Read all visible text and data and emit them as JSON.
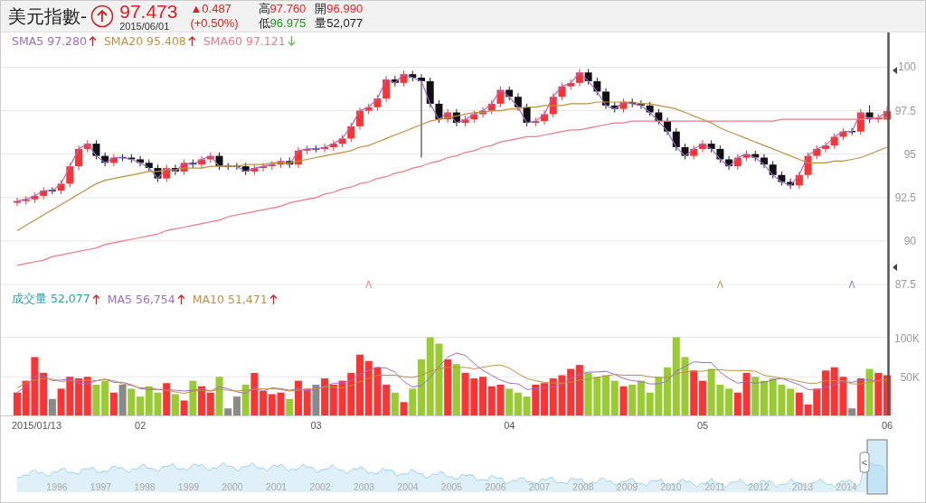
{
  "header": {
    "title": "美元指數-",
    "rising": true,
    "price": "97.473",
    "date": "2015/06/01",
    "change": "▲0.487",
    "change_pct": "(+0.50%)",
    "stats": [
      {
        "label": "高",
        "value": "97.760",
        "color": "#ff1a1a"
      },
      {
        "label": "開",
        "value": "96.990",
        "color": "#ff1a1a"
      },
      {
        "label": "低",
        "value": "96.975",
        "color": "#1a9a1a"
      },
      {
        "label": "量",
        "value": "52,077",
        "color": "#222222"
      }
    ]
  },
  "price_legend": [
    {
      "value": "97.280",
      "rising": true
    },
    {
      "value": "95.408",
      "rising": true
    },
    {
      "value": "97.121",
      "rising": false
    }
  ],
  "price_chart": {
    "chart_data": {
      "type": "candlestick",
      "grid": true,
      "ylim": [
        87.5,
        102
      ],
      "yticks": [
        87.5,
        90,
        92.5,
        95,
        97.5,
        100
      ],
      "ohlc": [
        [
          92.2,
          92.5,
          92.0,
          92.3
        ],
        [
          92.3,
          92.6,
          92.1,
          92.4
        ],
        [
          92.4,
          92.8,
          92.2,
          92.6
        ],
        [
          92.6,
          93.1,
          92.4,
          92.9
        ],
        [
          92.9,
          93.1,
          92.7,
          92.9
        ],
        [
          92.9,
          93.5,
          92.7,
          93.3
        ],
        [
          93.3,
          94.5,
          93.1,
          94.3
        ],
        [
          94.3,
          95.5,
          94.1,
          95.3
        ],
        [
          95.3,
          95.8,
          95.1,
          95.6
        ],
        [
          95.6,
          95.8,
          94.7,
          94.9
        ],
        [
          94.9,
          95.1,
          94.3,
          94.5
        ],
        [
          94.5,
          95.0,
          94.3,
          94.8
        ],
        [
          94.8,
          95.0,
          94.6,
          94.8
        ],
        [
          94.8,
          95.0,
          94.5,
          94.7
        ],
        [
          94.7,
          94.9,
          94.3,
          94.5
        ],
        [
          94.5,
          94.7,
          94.0,
          94.2
        ],
        [
          94.2,
          94.4,
          93.4,
          93.6
        ],
        [
          93.6,
          94.4,
          93.4,
          94.2
        ],
        [
          94.2,
          94.4,
          93.8,
          94.0
        ],
        [
          94.0,
          94.7,
          93.8,
          94.5
        ],
        [
          94.5,
          94.7,
          94.2,
          94.4
        ],
        [
          94.4,
          94.9,
          94.2,
          94.7
        ],
        [
          94.7,
          95.1,
          94.5,
          94.9
        ],
        [
          94.9,
          95.1,
          94.1,
          94.3
        ],
        [
          94.3,
          94.5,
          94.1,
          94.3
        ],
        [
          94.3,
          94.5,
          94.1,
          94.3
        ],
        [
          94.3,
          94.5,
          93.8,
          94.0
        ],
        [
          94.0,
          94.4,
          93.8,
          94.2
        ],
        [
          94.2,
          94.5,
          94.0,
          94.3
        ],
        [
          94.3,
          94.6,
          94.1,
          94.4
        ],
        [
          94.4,
          94.8,
          94.2,
          94.6
        ],
        [
          94.6,
          94.8,
          94.2,
          94.4
        ],
        [
          94.4,
          95.4,
          94.2,
          95.2
        ],
        [
          95.2,
          95.5,
          95.0,
          95.3
        ],
        [
          95.3,
          95.5,
          95.1,
          95.3
        ],
        [
          95.3,
          95.6,
          95.1,
          95.4
        ],
        [
          95.4,
          95.8,
          95.2,
          95.6
        ],
        [
          95.6,
          96.1,
          95.4,
          95.9
        ],
        [
          95.9,
          96.8,
          95.7,
          96.6
        ],
        [
          96.6,
          97.7,
          96.4,
          97.5
        ],
        [
          97.5,
          97.9,
          97.3,
          97.7
        ],
        [
          97.7,
          98.4,
          97.5,
          98.2
        ],
        [
          98.2,
          99.5,
          98.0,
          99.3
        ],
        [
          99.3,
          99.5,
          98.9,
          99.1
        ],
        [
          99.1,
          99.8,
          98.9,
          99.6
        ],
        [
          99.6,
          99.8,
          99.2,
          99.4
        ],
        [
          99.4,
          99.6,
          94.8,
          99.2
        ],
        [
          99.2,
          99.4,
          97.7,
          97.9
        ],
        [
          97.9,
          98.1,
          96.8,
          97.0
        ],
        [
          97.0,
          97.6,
          96.8,
          97.4
        ],
        [
          97.4,
          97.6,
          96.6,
          96.8
        ],
        [
          96.8,
          97.2,
          96.6,
          97.0
        ],
        [
          97.0,
          97.5,
          96.8,
          97.3
        ],
        [
          97.3,
          97.7,
          97.1,
          97.5
        ],
        [
          97.5,
          98.1,
          97.3,
          97.9
        ],
        [
          97.9,
          98.9,
          97.7,
          98.7
        ],
        [
          98.7,
          98.9,
          98.1,
          98.3
        ],
        [
          98.3,
          98.5,
          97.5,
          97.7
        ],
        [
          97.7,
          97.9,
          96.6,
          96.8
        ],
        [
          96.8,
          97.1,
          96.6,
          96.9
        ],
        [
          96.9,
          97.5,
          96.7,
          97.3
        ],
        [
          97.3,
          98.5,
          97.1,
          98.3
        ],
        [
          98.3,
          99.1,
          98.1,
          98.9
        ],
        [
          98.9,
          99.3,
          98.7,
          99.1
        ],
        [
          99.1,
          99.9,
          98.9,
          99.7
        ],
        [
          99.7,
          99.9,
          99.0,
          99.2
        ],
        [
          99.2,
          99.4,
          98.4,
          98.6
        ],
        [
          98.6,
          98.8,
          97.6,
          97.8
        ],
        [
          97.8,
          98.0,
          97.4,
          97.6
        ],
        [
          97.6,
          98.2,
          97.4,
          98.0
        ],
        [
          98.0,
          98.2,
          97.7,
          97.9
        ],
        [
          97.9,
          98.1,
          97.6,
          97.8
        ],
        [
          97.8,
          98.0,
          97.2,
          97.4
        ],
        [
          97.4,
          97.6,
          96.7,
          96.9
        ],
        [
          96.9,
          97.1,
          96.1,
          96.3
        ],
        [
          96.3,
          96.5,
          95.2,
          95.4
        ],
        [
          95.4,
          95.6,
          94.7,
          94.9
        ],
        [
          94.9,
          95.5,
          94.7,
          95.3
        ],
        [
          95.3,
          95.8,
          95.1,
          95.6
        ],
        [
          95.6,
          95.8,
          95.1,
          95.3
        ],
        [
          95.3,
          95.5,
          94.5,
          94.7
        ],
        [
          94.7,
          94.9,
          94.1,
          94.3
        ],
        [
          94.3,
          95.0,
          94.1,
          94.8
        ],
        [
          94.8,
          95.2,
          94.6,
          95.0
        ],
        [
          95.0,
          95.2,
          94.6,
          94.8
        ],
        [
          94.8,
          95.0,
          94.2,
          94.4
        ],
        [
          94.4,
          94.6,
          93.6,
          93.8
        ],
        [
          93.8,
          94.0,
          93.2,
          93.4
        ],
        [
          93.4,
          93.6,
          93.0,
          93.2
        ],
        [
          93.2,
          94.0,
          93.0,
          93.8
        ],
        [
          93.8,
          95.1,
          93.6,
          94.9
        ],
        [
          94.9,
          95.5,
          94.7,
          95.3
        ],
        [
          95.3,
          95.7,
          95.1,
          95.5
        ],
        [
          95.5,
          96.2,
          95.3,
          96.0
        ],
        [
          96.0,
          96.5,
          95.8,
          96.3
        ],
        [
          96.3,
          96.5,
          96.1,
          96.3
        ],
        [
          96.3,
          97.6,
          96.1,
          97.4
        ],
        [
          97.4,
          97.8,
          96.8,
          97.0
        ],
        [
          97.0,
          97.3,
          96.8,
          97.1
        ],
        [
          96.99,
          97.76,
          96.975,
          97.473
        ]
      ],
      "series": [
        {
          "name": "SMA5",
          "type": "line",
          "color": "#9a6ccc",
          "values": [
            92.3,
            92.4,
            92.6,
            92.9,
            92.9,
            93.3,
            94.3,
            95.3,
            95.6,
            94.9,
            94.5,
            94.8,
            94.8,
            94.7,
            94.5,
            94.2,
            93.6,
            94.2,
            94.0,
            94.5,
            94.4,
            94.7,
            94.9,
            94.3,
            94.3,
            94.3,
            94.0,
            94.2,
            94.3,
            94.4,
            94.6,
            94.4,
            95.2,
            95.3,
            95.3,
            95.4,
            95.6,
            95.9,
            96.6,
            97.5,
            97.7,
            98.2,
            99.3,
            99.1,
            99.6,
            99.4,
            99.2,
            97.9,
            97.0,
            97.4,
            96.8,
            97.0,
            97.3,
            97.5,
            97.9,
            98.7,
            98.3,
            97.7,
            96.8,
            96.9,
            97.3,
            98.3,
            98.9,
            99.1,
            99.7,
            99.2,
            98.6,
            97.8,
            97.6,
            98.0,
            97.9,
            97.8,
            97.4,
            96.9,
            96.3,
            95.4,
            94.9,
            95.3,
            95.6,
            95.3,
            94.7,
            94.3,
            94.8,
            95.0,
            94.8,
            94.4,
            93.8,
            93.4,
            93.2,
            93.8,
            94.9,
            95.3,
            95.5,
            96.0,
            96.3,
            96.3,
            97.4,
            97.0,
            97.1,
            97.47
          ]
        },
        {
          "name": "SMA20",
          "type": "line",
          "color": "#c09040",
          "values": [
            90.6,
            90.9,
            91.2,
            91.5,
            91.8,
            92.1,
            92.4,
            92.7,
            93.0,
            93.3,
            93.5,
            93.6,
            93.7,
            93.8,
            93.9,
            94.0,
            94.0,
            94.1,
            94.1,
            94.2,
            94.2,
            94.2,
            94.3,
            94.3,
            94.3,
            94.3,
            94.4,
            94.4,
            94.4,
            94.5,
            94.5,
            94.5,
            94.6,
            94.7,
            94.8,
            94.9,
            95.0,
            95.1,
            95.2,
            95.4,
            95.5,
            95.7,
            95.9,
            96.1,
            96.3,
            96.5,
            96.7,
            96.9,
            97.0,
            97.1,
            97.2,
            97.3,
            97.4,
            97.4,
            97.5,
            97.5,
            97.6,
            97.6,
            97.7,
            97.7,
            97.8,
            97.8,
            97.8,
            97.9,
            97.9,
            97.9,
            98.0,
            98.0,
            98.0,
            98.0,
            98.0,
            97.9,
            97.9,
            97.8,
            97.7,
            97.6,
            97.4,
            97.2,
            97.0,
            96.8,
            96.5,
            96.3,
            96.1,
            95.9,
            95.7,
            95.5,
            95.3,
            95.1,
            94.9,
            94.7,
            94.5,
            94.5,
            94.5,
            94.6,
            94.6,
            94.7,
            94.8,
            95.0,
            95.2,
            95.4
          ]
        },
        {
          "name": "SMA60",
          "type": "line",
          "color": "#f07a84",
          "values": [
            88.6,
            88.7,
            88.8,
            88.9,
            89.1,
            89.2,
            89.3,
            89.4,
            89.5,
            89.6,
            89.8,
            89.9,
            90.0,
            90.1,
            90.2,
            90.3,
            90.4,
            90.6,
            90.7,
            90.8,
            90.9,
            91.0,
            91.1,
            91.2,
            91.4,
            91.5,
            91.6,
            91.7,
            91.8,
            91.9,
            92.0,
            92.2,
            92.3,
            92.4,
            92.5,
            92.7,
            92.8,
            93.0,
            93.1,
            93.3,
            93.4,
            93.6,
            93.7,
            93.9,
            94.0,
            94.2,
            94.3,
            94.5,
            94.6,
            94.8,
            94.9,
            95.1,
            95.2,
            95.4,
            95.5,
            95.7,
            95.8,
            95.9,
            96.0,
            96.0,
            96.1,
            96.2,
            96.3,
            96.4,
            96.4,
            96.5,
            96.6,
            96.7,
            96.8,
            96.8,
            96.9,
            96.9,
            96.9,
            96.9,
            96.9,
            96.9,
            96.9,
            96.9,
            96.9,
            96.9,
            96.9,
            96.9,
            96.9,
            96.9,
            96.9,
            96.9,
            96.9,
            97.0,
            97.0,
            97.0,
            97.0,
            97.0,
            97.0,
            97.0,
            97.0,
            97.0,
            97.0,
            97.1,
            97.1,
            97.1
          ]
        }
      ]
    }
  },
  "volume_legend": [
    {
      "value": "52,077",
      "color": "#20a8b0",
      "rising": true
    },
    {
      "value": "56,754",
      "rising": true
    },
    {
      "value": "51,471",
      "rising": true
    }
  ],
  "volume_chart": {
    "chart_data": {
      "type": "bar",
      "grid": true,
      "ylim": [
        0,
        160
      ],
      "yticks": [
        {
          "value": 50,
          "label": "50K"
        },
        {
          "value": 100,
          "label": "100K"
        }
      ],
      "series": [
        {
          "name": "成交量",
          "colors": [
            "#ff3333",
            "#ff3333",
            "#ff3333",
            "#ff3333",
            "#8a8a8a",
            "#ff3333",
            "#ff3333",
            "#ff3333",
            "#ff3333",
            "#99cc33",
            "#99cc33",
            "#ff3333",
            "#8a8a8a",
            "#99cc33",
            "#99cc33",
            "#99cc33",
            "#99cc33",
            "#ff3333",
            "#99cc33",
            "#ff3333",
            "#99cc33",
            "#ff3333",
            "#ff3333",
            "#99cc33",
            "#8a8a8a",
            "#8a8a8a",
            "#99cc33",
            "#ff3333",
            "#ff3333",
            "#ff3333",
            "#ff3333",
            "#99cc33",
            "#ff3333",
            "#ff3333",
            "#8a8a8a",
            "#ff3333",
            "#ff3333",
            "#ff3333",
            "#ff3333",
            "#ff3333",
            "#ff3333",
            "#ff3333",
            "#ff3333",
            "#99cc33",
            "#ff3333",
            "#99cc33",
            "#99cc33",
            "#99cc33",
            "#99cc33",
            "#ff3333",
            "#99cc33",
            "#ff3333",
            "#ff3333",
            "#ff3333",
            "#ff3333",
            "#ff3333",
            "#99cc33",
            "#99cc33",
            "#99cc33",
            "#ff3333",
            "#ff3333",
            "#ff3333",
            "#ff3333",
            "#ff3333",
            "#ff3333",
            "#99cc33",
            "#99cc33",
            "#99cc33",
            "#99cc33",
            "#ff3333",
            "#99cc33",
            "#99cc33",
            "#99cc33",
            "#99cc33",
            "#99cc33",
            "#99cc33",
            "#99cc33",
            "#ff3333",
            "#ff3333",
            "#99cc33",
            "#99cc33",
            "#99cc33",
            "#ff3333",
            "#ff3333",
            "#99cc33",
            "#99cc33",
            "#99cc33",
            "#99cc33",
            "#99cc33",
            "#ff3333",
            "#ff3333",
            "#ff3333",
            "#ff3333",
            "#ff3333",
            "#ff3333",
            "#8a8a8a",
            "#ff3333",
            "#99cc33",
            "#ff3333",
            "#ff3333"
          ],
          "values": [
            30,
            45,
            75,
            55,
            22,
            35,
            50,
            48,
            50,
            40,
            45,
            30,
            40,
            35,
            25,
            38,
            30,
            42,
            28,
            20,
            45,
            38,
            30,
            50,
            10,
            25,
            40,
            55,
            32,
            28,
            30,
            22,
            45,
            35,
            40,
            48,
            40,
            45,
            55,
            78,
            70,
            62,
            40,
            30,
            18,
            35,
            72,
            100,
            92,
            72,
            66,
            55,
            48,
            50,
            38,
            40,
            35,
            30,
            25,
            40,
            42,
            48,
            52,
            60,
            65,
            55,
            50,
            52,
            45,
            38,
            40,
            45,
            30,
            50,
            62,
            100,
            75,
            58,
            45,
            60,
            40,
            35,
            30,
            55,
            50,
            45,
            48,
            40,
            35,
            30,
            15,
            35,
            58,
            62,
            50,
            10,
            48,
            60,
            55,
            52
          ]
        },
        {
          "name": "MA5",
          "type": "line",
          "color": "#9a6ccc",
          "values": [
            30,
            38,
            50,
            51,
            45,
            46,
            47,
            42,
            41,
            45,
            47,
            43,
            43,
            40,
            35,
            34,
            34,
            34,
            33,
            32,
            33,
            35,
            32,
            37,
            35,
            31,
            29,
            36,
            32,
            36,
            35,
            33,
            35,
            32,
            34,
            38,
            42,
            42,
            46,
            53,
            58,
            62,
            61,
            56,
            44,
            37,
            39,
            49,
            63,
            75,
            80,
            77,
            67,
            58,
            52,
            46,
            42,
            41,
            34,
            35,
            36,
            37,
            41,
            48,
            53,
            56,
            56,
            57,
            53,
            48,
            45,
            44,
            41,
            41,
            45,
            57,
            63,
            69,
            68,
            68,
            56,
            48,
            42,
            44,
            42,
            43,
            46,
            48,
            44,
            40,
            34,
            33,
            37,
            40,
            44,
            43,
            46,
            46,
            45,
            45
          ]
        },
        {
          "name": "MA10",
          "type": "line",
          "color": "#c09040",
          "values": [
            36,
            42,
            46,
            48,
            47,
            44,
            45,
            45,
            46,
            45,
            47,
            45,
            41,
            39,
            36,
            36,
            34,
            33,
            31,
            29,
            32,
            33,
            32,
            34,
            33,
            32,
            33,
            34,
            35,
            35,
            34,
            32,
            33,
            34,
            35,
            37,
            37,
            36,
            39,
            44,
            48,
            52,
            52,
            52,
            50,
            49,
            52,
            57,
            60,
            62,
            62,
            62,
            60,
            62,
            64,
            65,
            61,
            54,
            48,
            45,
            43,
            42,
            42,
            43,
            46,
            47,
            49,
            51,
            53,
            52,
            52,
            52,
            50,
            49,
            49,
            54,
            56,
            57,
            57,
            59,
            59,
            58,
            58,
            58,
            57,
            52,
            50,
            48,
            47,
            44,
            42,
            42,
            45,
            45,
            45,
            41,
            41,
            43,
            45,
            47
          ]
        }
      ]
    }
  },
  "x_axis_labels": [
    "2015/01/13",
    "02",
    "03",
    "04",
    "05",
    "06"
  ],
  "navigator": {
    "years": [
      "1996",
      "1997",
      "1998",
      "1999",
      "2000",
      "2001",
      "2002",
      "2003",
      "2004",
      "2005",
      "2006",
      "2007",
      "2008",
      "2009",
      "2010",
      "2011",
      "2012",
      "2013",
      "2014"
    ],
    "handle": "<"
  }
}
